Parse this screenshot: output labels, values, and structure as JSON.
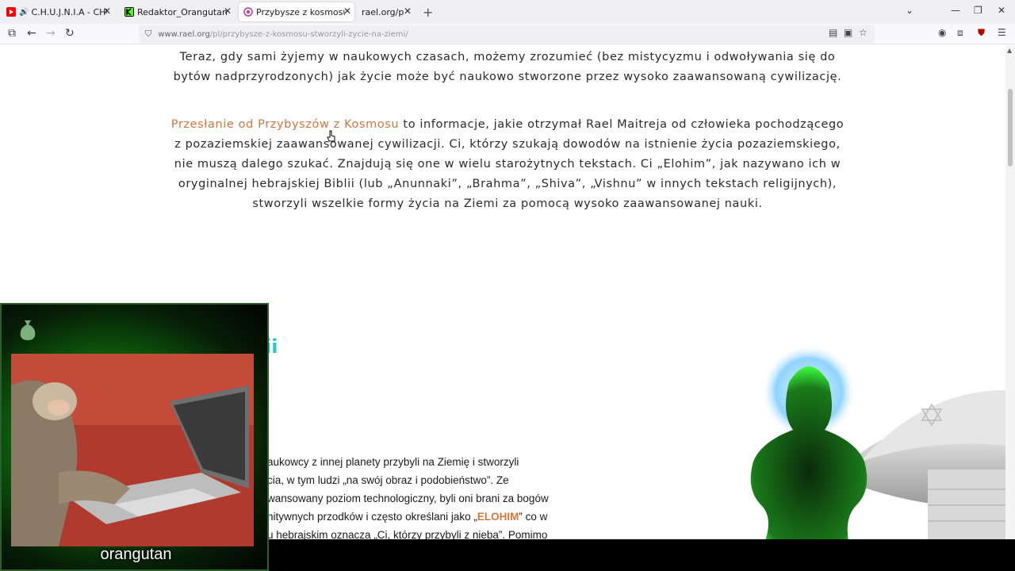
{
  "tabs": [
    {
      "title": "C.H.U.J.N.I.A - CHUJNIA - Yo",
      "favicon": "youtube-icon",
      "audio": true,
      "color": "#ff0000"
    },
    {
      "title": "Redaktor_Orangutan Stream - K",
      "favicon": "kick-icon",
      "audio": false,
      "color": "#53fc18"
    },
    {
      "title": "Przybysze z kosmosu stworzyli ż",
      "favicon": "rael-icon",
      "audio": false,
      "color": "#c0389a"
    },
    {
      "title": "rael.org/pl/ebo",
      "favicon": "",
      "audio": false,
      "color": ""
    }
  ],
  "url": {
    "host": "www.rael.org",
    "path": "/pl/przybysze-z-kosmosu-stworzyli-zycie-na-ziemi/"
  },
  "content": {
    "para1": "Teraz, gdy sami żyjemy w naukowych czasach, możemy zrozumieć (bez mistycyzmu i odwoływania się do bytów nadprzyrodzonych) jak życie może być naukowo stworzone przez wysoko zaawansowaną cywilizację.",
    "para2_link": "Przesłanie od Przybyszów z Kosmosu",
    "para2_rest": " to informacje, jakie otrzymał Rael Maitreja od człowieka pochodzącego z pozaziemskiej zaawansowanej cywilizacji. Ci, którzy szukają dowodów na istnienie życia pozaziemskiego, nie muszą dalego szukać. Znajdują się one w wielu starożytnych tekstach. Ci „Elohim”, jak nazywano ich w oryginalnej hebrajskiej Biblii (lub „Anunnaki”, „Brahma”, „Shiva”, „Vishnu” w innych tekstach religijnych), stworzyli wszelkie formy życia na Ziemi za pomocą wysoko zaawansowanej nauki.",
    "heading_fragment": "ii",
    "lower_lines": [
      "aukowcy z innej planety przybyli na Ziemię i stworzyli",
      "cia, w tym ludzi „na swój obraz i podobieństwo”. Ze",
      "wansowany poziom technologiczny, byli oni brani za bogów",
      "nitywnych przodków i często określani jako „",
      "u hebrajskim oznacza „Ci, którzy przybyli z nieba”. Pomimo"
    ],
    "elohim_word": "ELOHIM",
    "lower_line4_tail": "” co w"
  },
  "overlay": {
    "caption": "orangutan"
  },
  "colors": {
    "link": "#d2763e",
    "heading": "#2ec5c5",
    "overlay_glow": "#3aff3a"
  }
}
